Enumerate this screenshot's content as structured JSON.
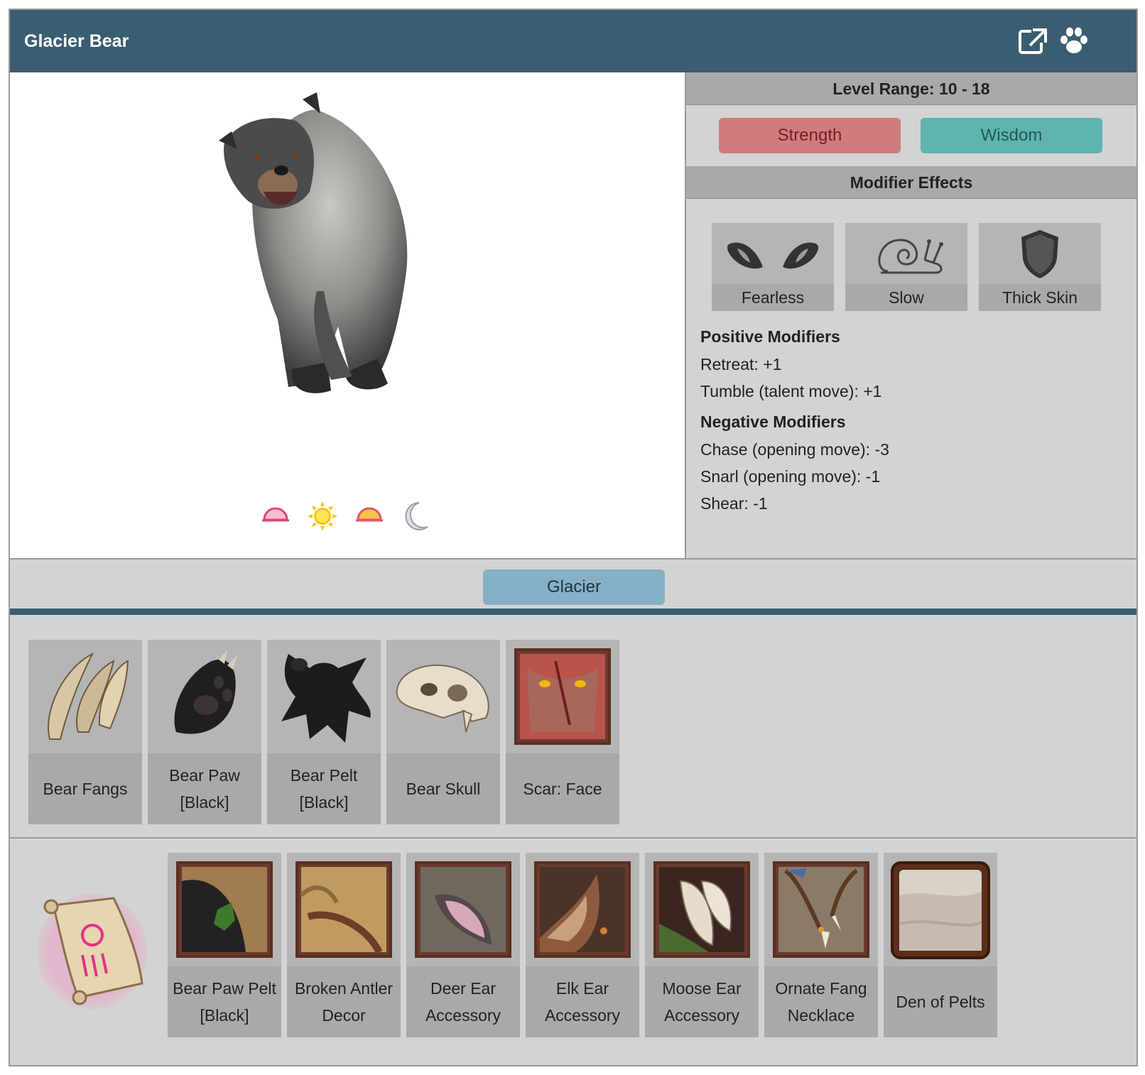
{
  "window": {
    "title": "Glacier Bear"
  },
  "header_icons": {
    "open": "external-link-icon",
    "paw": "paw-icon"
  },
  "level_range": "Level Range: 10 - 18",
  "stats": {
    "primary": "Strength",
    "secondary": "Wisdom"
  },
  "modifier_effects": {
    "heading": "Modifier Effects",
    "items": [
      {
        "label": "Fearless",
        "icon": "eyes-icon"
      },
      {
        "label": "Slow",
        "icon": "snail-icon"
      },
      {
        "label": "Thick Skin",
        "icon": "shield-icon"
      }
    ]
  },
  "positive_modifiers": {
    "heading": "Positive Modifiers",
    "lines": [
      "Retreat: +1",
      "Tumble (talent move): +1"
    ]
  },
  "negative_modifiers": {
    "heading": "Negative Modifiers",
    "lines": [
      "Chase (opening move): -3",
      "Snarl (opening move): -1",
      "Shear: -1"
    ]
  },
  "activity_times": [
    "dawn-icon",
    "day-icon",
    "dusk-icon",
    "night-icon"
  ],
  "biome": "Glacier",
  "drops": [
    {
      "label": "Bear Fangs",
      "icon": "fangs-icon"
    },
    {
      "label": "Bear Paw [Black]",
      "icon": "paw-item-icon"
    },
    {
      "label": "Bear Pelt [Black]",
      "icon": "pelt-icon"
    },
    {
      "label": "Bear Skull",
      "icon": "skull-icon"
    },
    {
      "label": "Scar: Face",
      "icon": "scar-icon"
    }
  ],
  "unlocks": [
    {
      "label": "Bear Paw Pelt [Black]",
      "icon": "paw-pelt-icon"
    },
    {
      "label": "Broken Antler Decor",
      "icon": "antler-icon"
    },
    {
      "label": "Deer Ear Accessory",
      "icon": "deer-ear-icon"
    },
    {
      "label": "Elk Ear Accessory",
      "icon": "elk-ear-icon"
    },
    {
      "label": "Moose Ear Accessory",
      "icon": "moose-ear-icon"
    },
    {
      "label": "Ornate Fang Necklace",
      "icon": "necklace-icon"
    },
    {
      "label": "Den of Pelts",
      "icon": "den-icon"
    }
  ],
  "colors": {
    "header": "#3a5e71",
    "strength": "#d07c7c",
    "wisdom": "#5fb4ae",
    "biome": "#86b0c6"
  }
}
